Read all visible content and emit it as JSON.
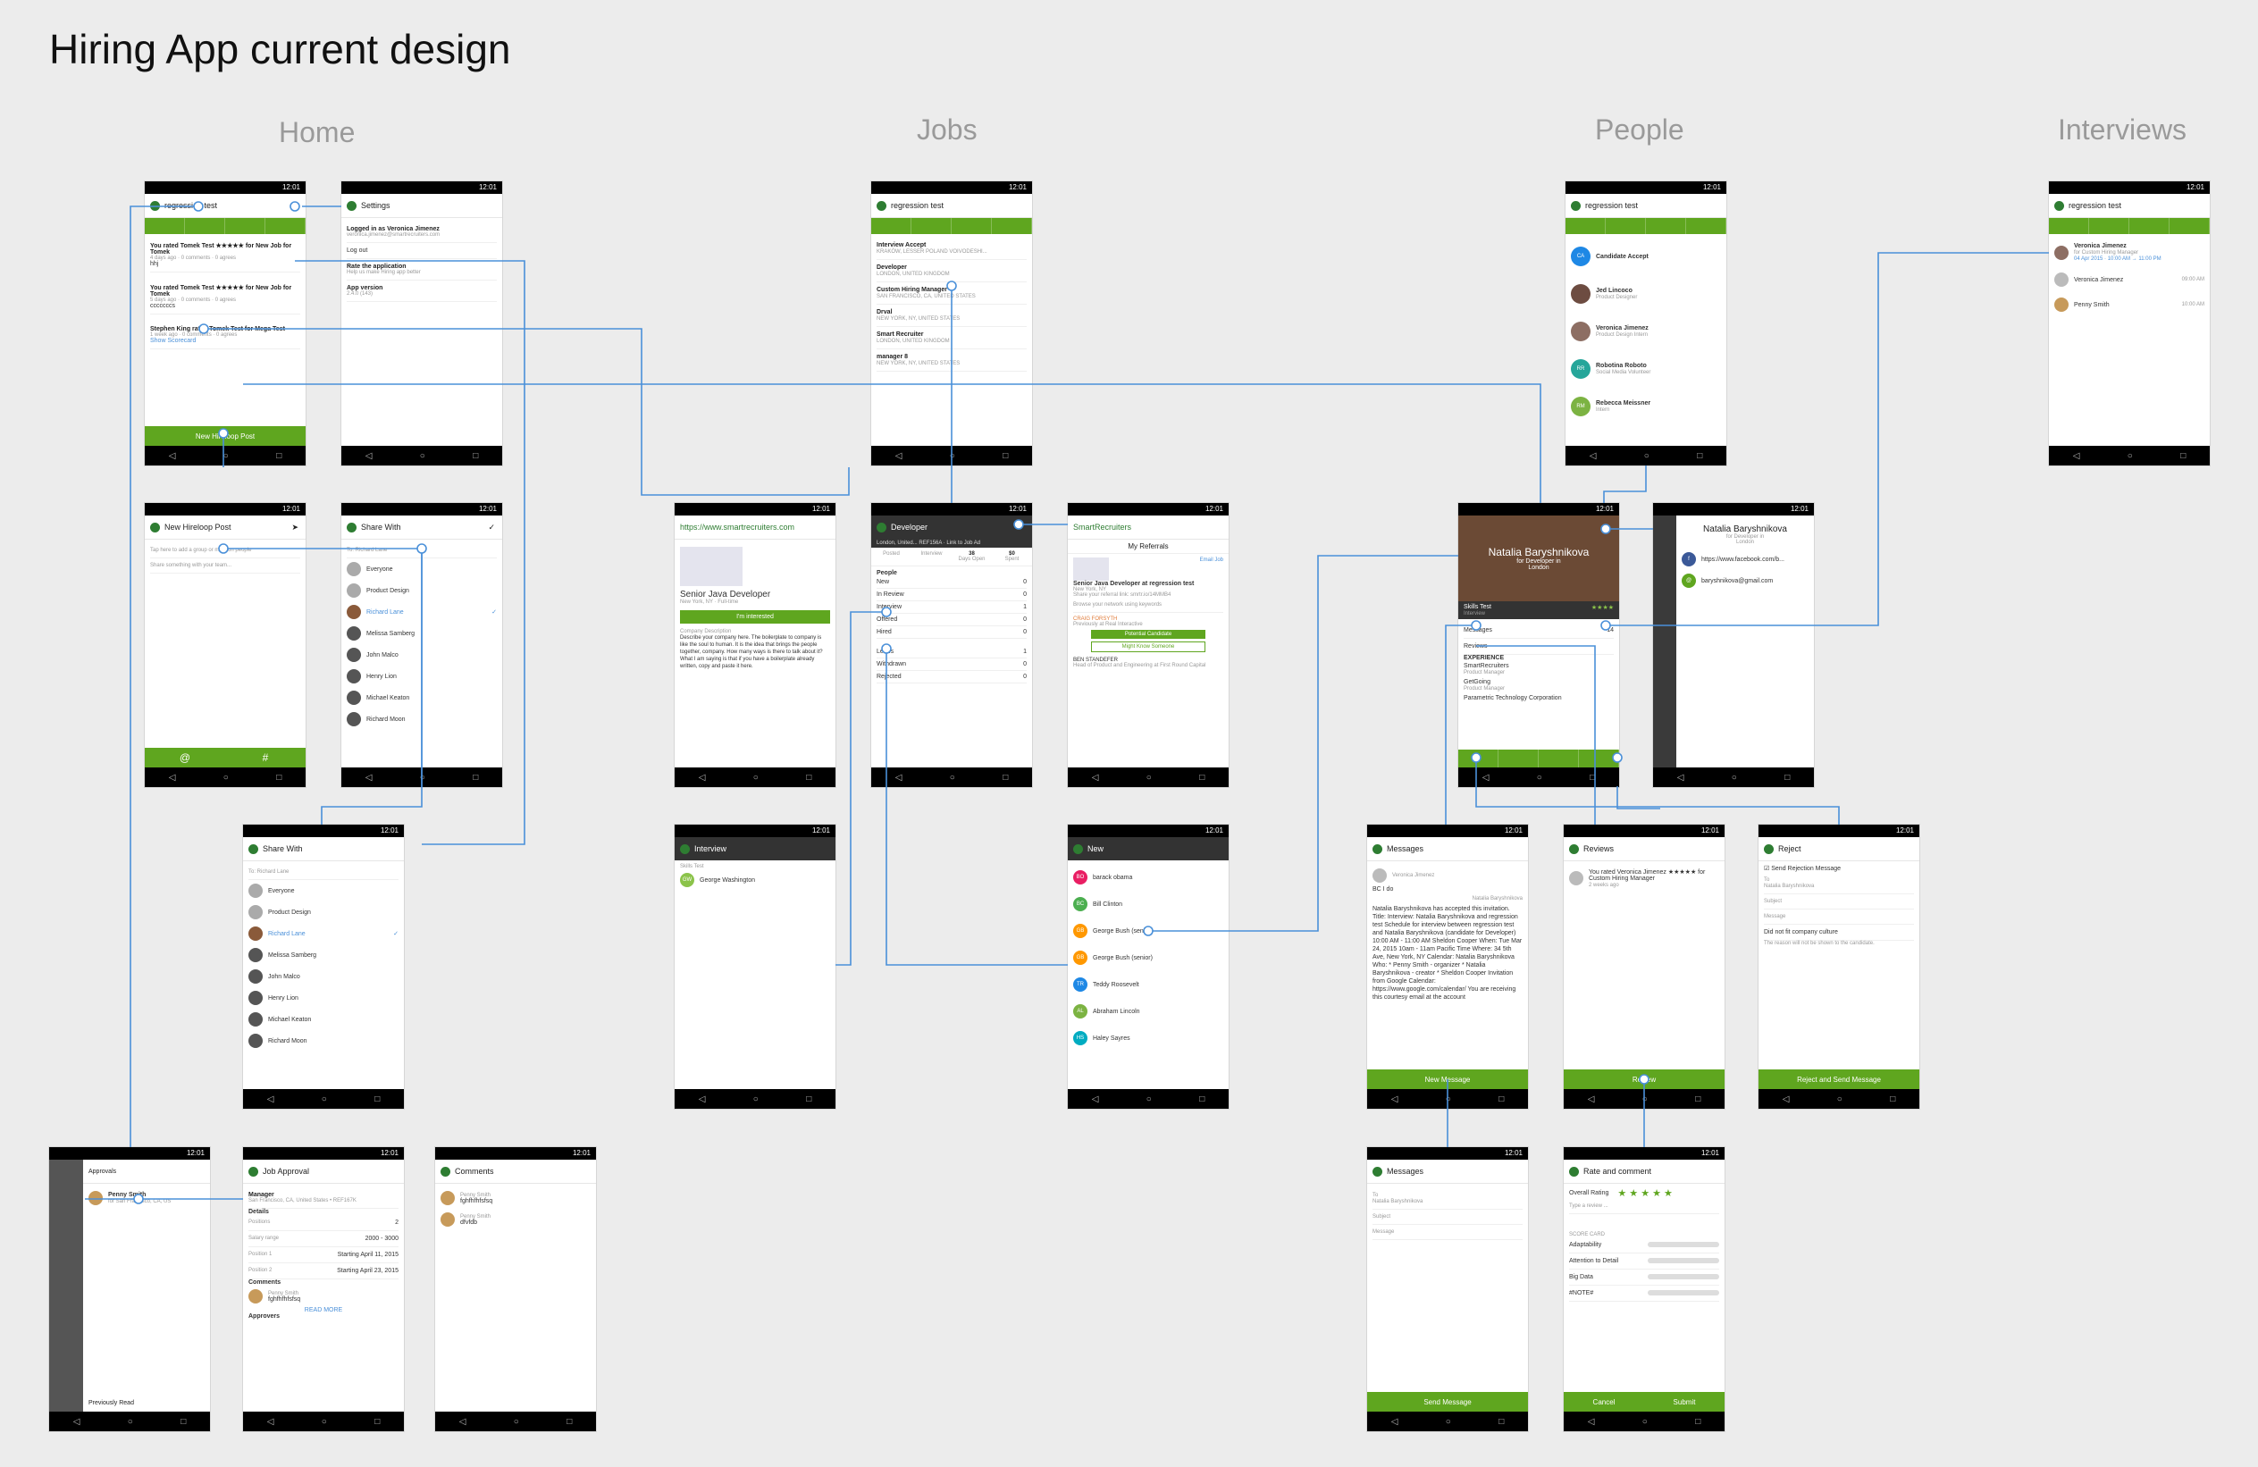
{
  "title": "Hiring App current design",
  "sections": {
    "home": "Home",
    "jobs": "Jobs",
    "people": "People",
    "interviews": "Interviews"
  },
  "common": {
    "status_time": "12:01",
    "app_name": "regression test",
    "nav": [
      "◁",
      "○",
      "□"
    ]
  },
  "home": {
    "feed": {
      "items": [
        {
          "line": "You rated Tomek Test ★★★★★ for New Job for Tomek",
          "meta": "4 days ago · 0 comments · 0 agrees",
          "text": "hhj"
        },
        {
          "line": "You rated Tomek Test ★★★★★ for New Job for Tomek",
          "meta": "5 days ago · 0 comments · 0 agrees",
          "text": "cccccccs"
        },
        {
          "line": "Stephen King rated Tomek Test for Mega Test",
          "meta": "1 week ago · 0 comments · 0 agrees",
          "text": "Show Scorecard"
        }
      ],
      "button": "New Hireloop Post"
    },
    "settings": {
      "title": "Settings",
      "logged": "Logged in as Veronica Jimenez",
      "email": "veronica.jimenez@smartrecruiters.com",
      "logout": "Log out",
      "rate": "Rate the application",
      "rate_sub": "Help us make Hiring app better",
      "version": "App version",
      "version_value": "2.4.0 (143)"
    },
    "new_post": {
      "title": "New Hireloop Post",
      "tag_hint": "Tap here to add a group or mention people",
      "share_hint": "Share something with your team..."
    },
    "share": {
      "title": "Share With",
      "to": "Richard Lane",
      "people": [
        "Everyone",
        "Product Design",
        "Richard Lane",
        "Melissa Samberg",
        "John Malco",
        "Henry Lion",
        "Michael Keaton",
        "Richard Moon"
      ]
    },
    "approvals": {
      "title": "Approvals",
      "person": "Penny Smith",
      "sub": "for San Francisco, CA, US",
      "footer": "Previously Read"
    },
    "job_approval": {
      "title": "Job Approval",
      "job": "Manager",
      "location": "San Francisco, CA, United States • REF167K",
      "details": "Details",
      "rows": [
        [
          "Positions",
          "2"
        ],
        [
          "Salary range",
          "2000 - 3000"
        ],
        [
          "Position 1",
          "Starting April 11, 2015"
        ],
        [
          "Position 2",
          "Starting April 23, 2015"
        ]
      ],
      "comments": "Comments",
      "comment_author": "Penny Smith",
      "comment_text": "fghfhfhfsfsq",
      "read_more": "READ MORE",
      "approvers": "Approvers"
    },
    "comments": {
      "title": "Comments",
      "items": [
        [
          "Penny Smith",
          "fghfhfhfsfsq"
        ],
        [
          "Penny Smith",
          "dfvfdb"
        ]
      ]
    }
  },
  "jobs": {
    "list": [
      [
        "Interview Accept",
        "KRAKÓW, LESSER POLAND VOIVODESHI..."
      ],
      [
        "Developer",
        "LONDON, UNITED KINGDOM"
      ],
      [
        "Custom Hiring Manager",
        "SAN FRANCISCO, CA, UNITED STATES"
      ],
      [
        "Drval",
        "NEW YORK, NY, UNITED STATES"
      ],
      [
        "Smart Recruiter",
        "LONDON, UNITED KINGDOM"
      ],
      [
        "manager 8",
        "NEW YORK, NY, UNITED STATES"
      ]
    ],
    "job_page": {
      "url": "https://www.smartrecruiters.com",
      "title": "Senior Java Developer",
      "location": "New York, NY · Full-time",
      "button": "I'm interested",
      "desc_title": "Company Description",
      "desc": "Describe your company here. The boilerplate to company is like the soul to human. It is the idea that brings the people together, company. How many ways is there to talk about it? What I am saying is that if you have a boilerplate already written, copy and paste it here."
    },
    "developer": {
      "title": "Developer",
      "subtitle": "London, United... REF156A · Link to Job Ad",
      "stats": [
        [
          "",
          "Posted"
        ],
        [
          "",
          "Interview"
        ],
        [
          "38",
          "Days Open"
        ],
        [
          "$0",
          "Spent"
        ]
      ],
      "people_label": "People",
      "stages": [
        [
          "New",
          "0"
        ],
        [
          "In Review",
          "0"
        ],
        [
          "Interview",
          "1"
        ],
        [
          "Offered",
          "0"
        ],
        [
          "Hired",
          "0"
        ],
        [
          "Leads",
          "1"
        ],
        [
          "Withdrawn",
          "0"
        ],
        [
          "Rejected",
          "0"
        ]
      ]
    },
    "referrals": {
      "brand": "SmartRecruiters",
      "title": "My Referrals",
      "email": "Email Job",
      "job": "Senior Java Developer at regression test",
      "loc": "New York, NY",
      "share": "Share your referral link: smrtr.io/14MMB4",
      "browse": "Browse your network using keywords",
      "p1": "CRAIG FORSYTH",
      "p1_sub": "Previously at Real Interactive",
      "b1": "Potential Candidate",
      "b2": "Might Know Someone",
      "p2": "BEN STANDEFER",
      "p2_sub": "Head of Product and Engineering at First Round Capital"
    },
    "interview": {
      "title": "Interview",
      "skills": "Skills Test",
      "candidate": "George Washington"
    },
    "new": {
      "title": "New",
      "people": [
        [
          "BO",
          "barack obama"
        ],
        [
          "BC",
          "Bill Clinton"
        ],
        [
          "GB",
          "George Bush (senior)"
        ],
        [
          "GB",
          "George Bush (senior)"
        ],
        [
          "TR",
          "Teddy Roosevelt"
        ],
        [
          "AL",
          "Abraham Lincoln"
        ],
        [
          "HS",
          "Haley Sayres"
        ]
      ]
    }
  },
  "people": {
    "list": [
      [
        "CA",
        "Candidate Accept",
        ""
      ],
      [
        "",
        "Jed Lincoco",
        "Product Designer"
      ],
      [
        "",
        "Veronica Jimenez",
        "Product Design Intern"
      ],
      [
        "RR",
        "Robotina Roboto",
        "Social Media Volunteer"
      ],
      [
        "RM",
        "Rebecca Meissner",
        "Intern"
      ]
    ],
    "profile": {
      "name": "Natalia Baryshnikova",
      "for": "for Developer in",
      "city": "London",
      "skills": "Skills Test",
      "interview": "Interview",
      "messages": "Messages",
      "messages_count": "14",
      "reviews": "Reviews",
      "experience": "EXPERIENCE",
      "exp": [
        [
          "SmartRecruiters",
          "Product Manager"
        ],
        [
          "GetGoing",
          "Product Manager"
        ],
        [
          "Parametric Technology Corporation",
          ""
        ]
      ]
    },
    "contact": {
      "name": "Natalia Baryshnikova",
      "for": "for Developer in",
      "city": "London",
      "facebook": "https://www.facebook.com/b...",
      "email": "baryshnikova@gmail.com"
    },
    "messages": {
      "title": "Messages",
      "from": "Veronica Jimenez",
      "first": "BC I do",
      "reply_from": "Natalia Baryshnikova",
      "body": "Natalia Baryshnikova has accepted this invitation. Title: Interview: Natalia Baryshnikova and regression test Schedule for interview between regression test and Natalia Baryshnikova (candidate for Developer) 10:00 AM - 11:00 AM Sheldon Cooper When: Tue Mar 24, 2015 10am - 11am Pacific Time Where: 34 5th Ave, New York, NY Calendar: Natalia Baryshnikova Who: * Penny Smith - organizer * Natalia Baryshnikova - creator * Sheldon Cooper Invitation from Google Calendar: https://www.google.com/calendar/ You are receiving this courtesy email at the account",
      "button": "New Message"
    },
    "reviews": {
      "title": "Reviews",
      "line": "You rated Veronica Jimenez ★★★★★ for Custom Hiring Manager",
      "meta": "2 weeks ago",
      "button": "Review"
    },
    "reject": {
      "title": "Reject",
      "send": "Send Rejection Message",
      "to": "To",
      "to_value": "Natalia Baryshnikova",
      "subject": "Subject",
      "message": "Message",
      "reason": "Did not fit company culture",
      "reason_note": "The reason will not be shown to the candidate.",
      "button": "Reject and Send Message"
    },
    "compose": {
      "title": "Messages",
      "to": "To",
      "to_value": "Natalia Baryshnikova",
      "subject": "Subject",
      "message": "Message",
      "button": "Send Message"
    },
    "rate": {
      "title": "Rate and comment",
      "overall": "Overall Rating",
      "stars": "★ ★ ★ ★ ★",
      "review_hint": "Type a review ...",
      "score_card": "SCORE CARD",
      "criteria": [
        "Adaptability",
        "Attention to Detail",
        "Big Data",
        "#NOTE#"
      ],
      "cancel": "Cancel",
      "submit": "Submit"
    }
  },
  "interviews": {
    "items": [
      [
        "Veronica Jimenez",
        "for Custom Hiring Manager",
        "04 Apr 2015 · 10:00 AM → 11:00 PM"
      ],
      [
        "Veronica Jimenez",
        "",
        "09:00 AM"
      ],
      [
        "Penny Smith",
        "",
        "10:00 AM"
      ]
    ]
  },
  "colors": {
    "green": "#5fa61f",
    "link": "#4a90d9",
    "dark_bar": "#333333",
    "background": "#ececec"
  }
}
